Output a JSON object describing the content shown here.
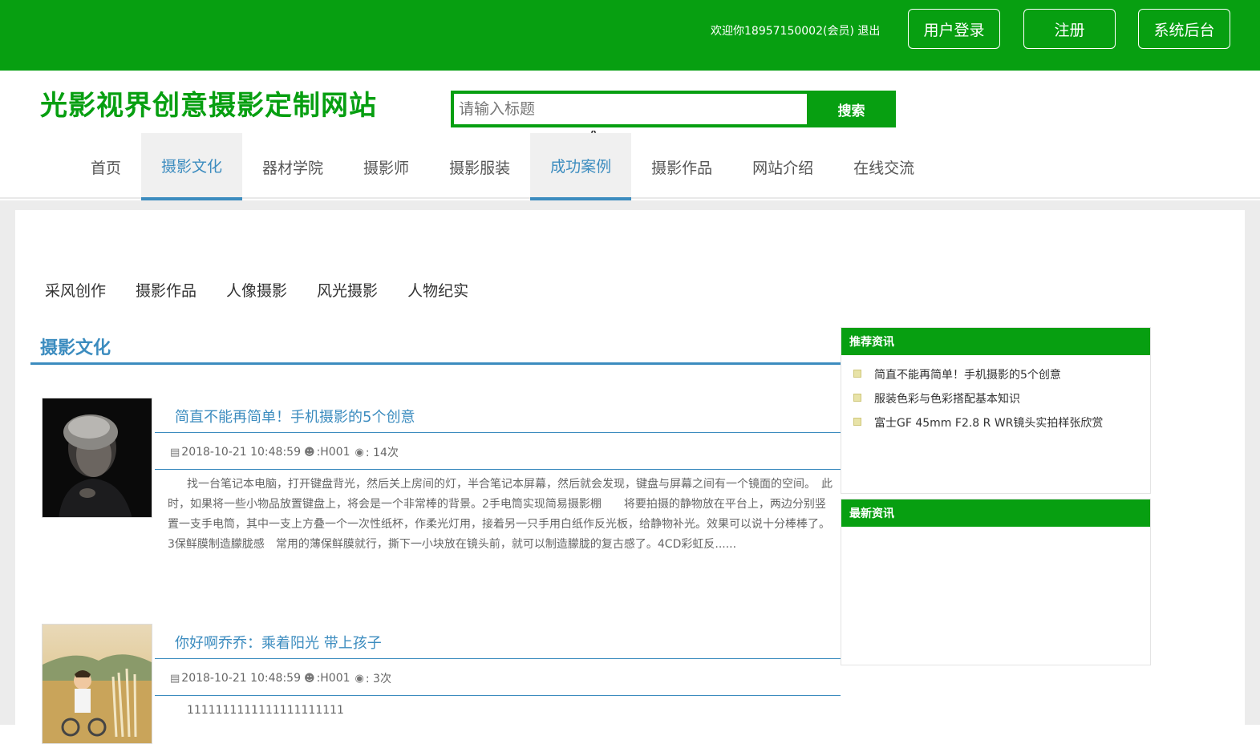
{
  "topbar": {
    "welcome_text": "欢迎你18957150002(会员)",
    "logout_label": "退出",
    "buttons": [
      "用户登录",
      "注册",
      "系统后台"
    ]
  },
  "header": {
    "site_title": "光影视界创意摄影定制网站",
    "search_placeholder": "请输入标题",
    "search_button": "搜索"
  },
  "nav": {
    "items": [
      "首页",
      "摄影文化",
      "器材学院",
      "摄影师",
      "摄影服装",
      "成功案例",
      "摄影作品",
      "网站介绍",
      "在线交流"
    ],
    "active": [
      "摄影文化",
      "成功案例"
    ]
  },
  "subnav": {
    "items": [
      "采风创作",
      "摄影作品",
      "人像摄影",
      "风光摄影",
      "人物纪实"
    ]
  },
  "section": {
    "title": "摄影文化"
  },
  "articles": [
    {
      "title": "简直不能再简单！手机摄影的5个创意",
      "date": "2018-10-21 10:48:59",
      "author": "H001",
      "views_label": ": 14次",
      "body": "找一台笔记本电脑，打开键盘背光，然后关上房间的灯，半合笔记本屏幕，然后就会发现，键盘与屏幕之间有一个镜面的空间。　此时，如果将一些小物品放置键盘上，将会是一个非常棒的背景。2手电筒实现简易摄影棚　　将要拍摄的静物放在平台上，两边分别竖置一支手电筒，其中一支上方叠一个一次性纸杯，作柔光灯用，接着另一只手用白纸作反光板，给静物补光。效果可以说十分棒棒了。3保鲜膜制造朦胧感　常用的薄保鲜膜就行，撕下一小块放在镜头前，就可以制造朦胧的复古感了。4CD彩虹反......"
    },
    {
      "title": "你好啊乔乔：乘着阳光 带上孩子",
      "date": "2018-10-21 10:48:59",
      "author": "H001",
      "views_label": ": 3次",
      "body": "1111111111111111111111"
    }
  ],
  "sidebar": {
    "recommended": {
      "title": "推荐资讯",
      "items": [
        "简直不能再简单！手机摄影的5个创意",
        "服装色彩与色彩搭配基本知识",
        "富士GF 45mm F2.8 R WR镜头实拍样张欣赏"
      ]
    },
    "latest": {
      "title": "最新资讯",
      "items": []
    }
  },
  "colors": {
    "brand_green": "#079f11",
    "accent_blue": "#3c8cbf"
  }
}
